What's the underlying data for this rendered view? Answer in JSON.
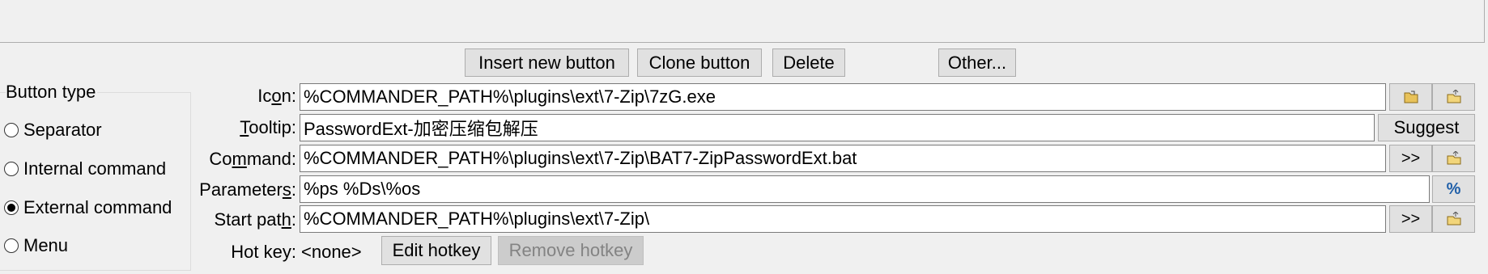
{
  "toolbar": {
    "insert_label": "Insert new button",
    "clone_label": "Clone button",
    "delete_label": "Delete",
    "other_label": "Other..."
  },
  "button_type": {
    "title": "Button type",
    "options": [
      "Separator",
      "Internal command",
      "External command",
      "Menu"
    ],
    "selected": "External command"
  },
  "form": {
    "icon": {
      "label_pre": "Ic",
      "label_u": "o",
      "label_post": "n:",
      "value": "%COMMANDER_PATH%\\plugins\\ext\\7-Zip\\7zG.exe"
    },
    "tooltip": {
      "label_pre": "",
      "label_u": "T",
      "label_post": "ooltip:",
      "value": "PasswordExt-加密压缩包解压",
      "suggest_label": "Suggest"
    },
    "command": {
      "label_pre": "Co",
      "label_u": "m",
      "label_post": "mand:",
      "value": "%COMMANDER_PATH%\\plugins\\ext\\7-Zip\\BAT7-ZipPasswordExt.bat",
      "browse_label": ">>"
    },
    "parameters": {
      "label_pre": "Parameter",
      "label_u": "s",
      "label_post": ":",
      "value": "%ps %Ds\\%os",
      "percent_label": "%"
    },
    "start_path": {
      "label_pre": "Start pat",
      "label_u": "h",
      "label_post": ":",
      "value": "%COMMANDER_PATH%\\plugins\\ext\\7-Zip\\",
      "browse_label": ">>"
    },
    "hotkey": {
      "label": "Hot key:",
      "value": "<none>",
      "edit_label": "Edit hotkey",
      "remove_label": "Remove hotkey"
    }
  },
  "icons": [
    "folder-open-icon",
    "open-icon"
  ],
  "colors": {
    "percent_button": "#1f5fa8",
    "disabled_text": "#838383"
  }
}
